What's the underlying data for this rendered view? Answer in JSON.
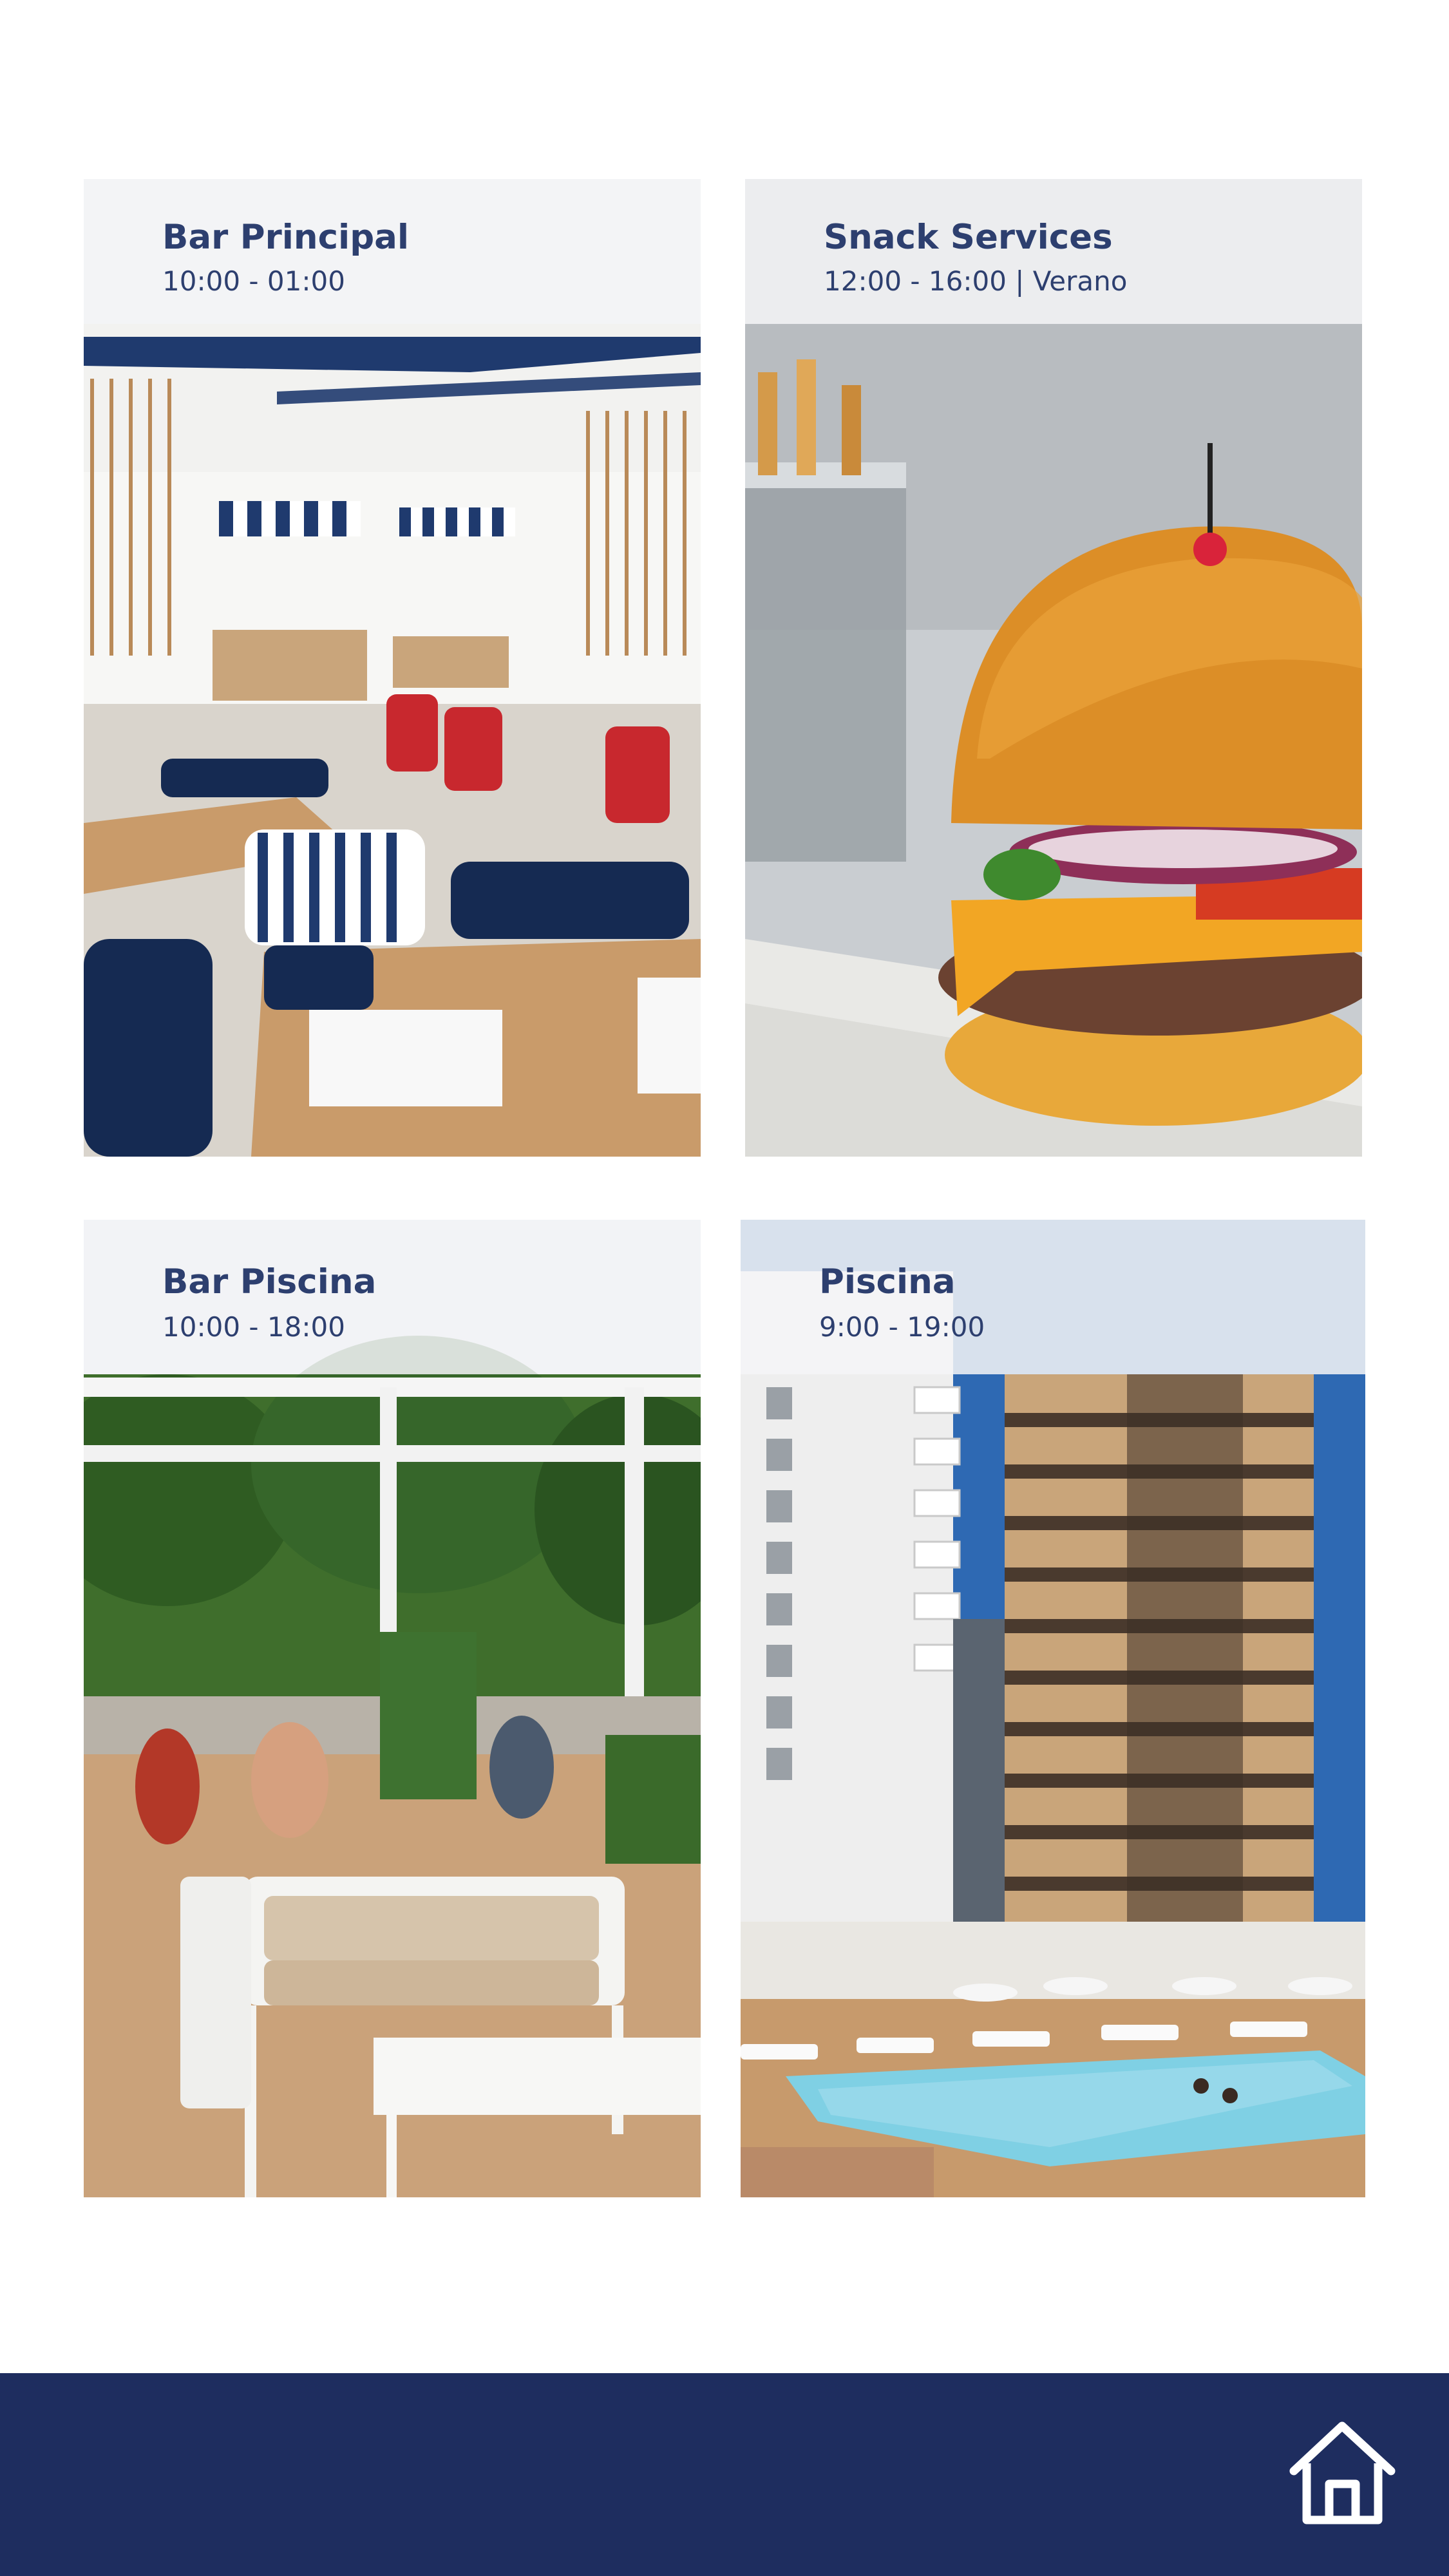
{
  "venues": [
    {
      "title": "Bar Principal",
      "hours": "10:00 - 01:00",
      "image": "restaurant-dining-room-photo"
    },
    {
      "title": "Snack Services",
      "hours": "12:00 - 16:00 | Verano",
      "image": "burger-closeup-photo"
    },
    {
      "title": "Bar Piscina",
      "hours": "10:00 - 18:00",
      "image": "pool-bar-terrace-photo"
    },
    {
      "title": "Piscina",
      "hours": "9:00 - 19:00",
      "image": "hotel-pool-buildings-photo"
    }
  ],
  "footer": {
    "background": "#1e2d5f",
    "home_icon": "home-icon"
  },
  "colors": {
    "title_text": "#2d3f6f",
    "label_panel": "#f5f5f7"
  }
}
